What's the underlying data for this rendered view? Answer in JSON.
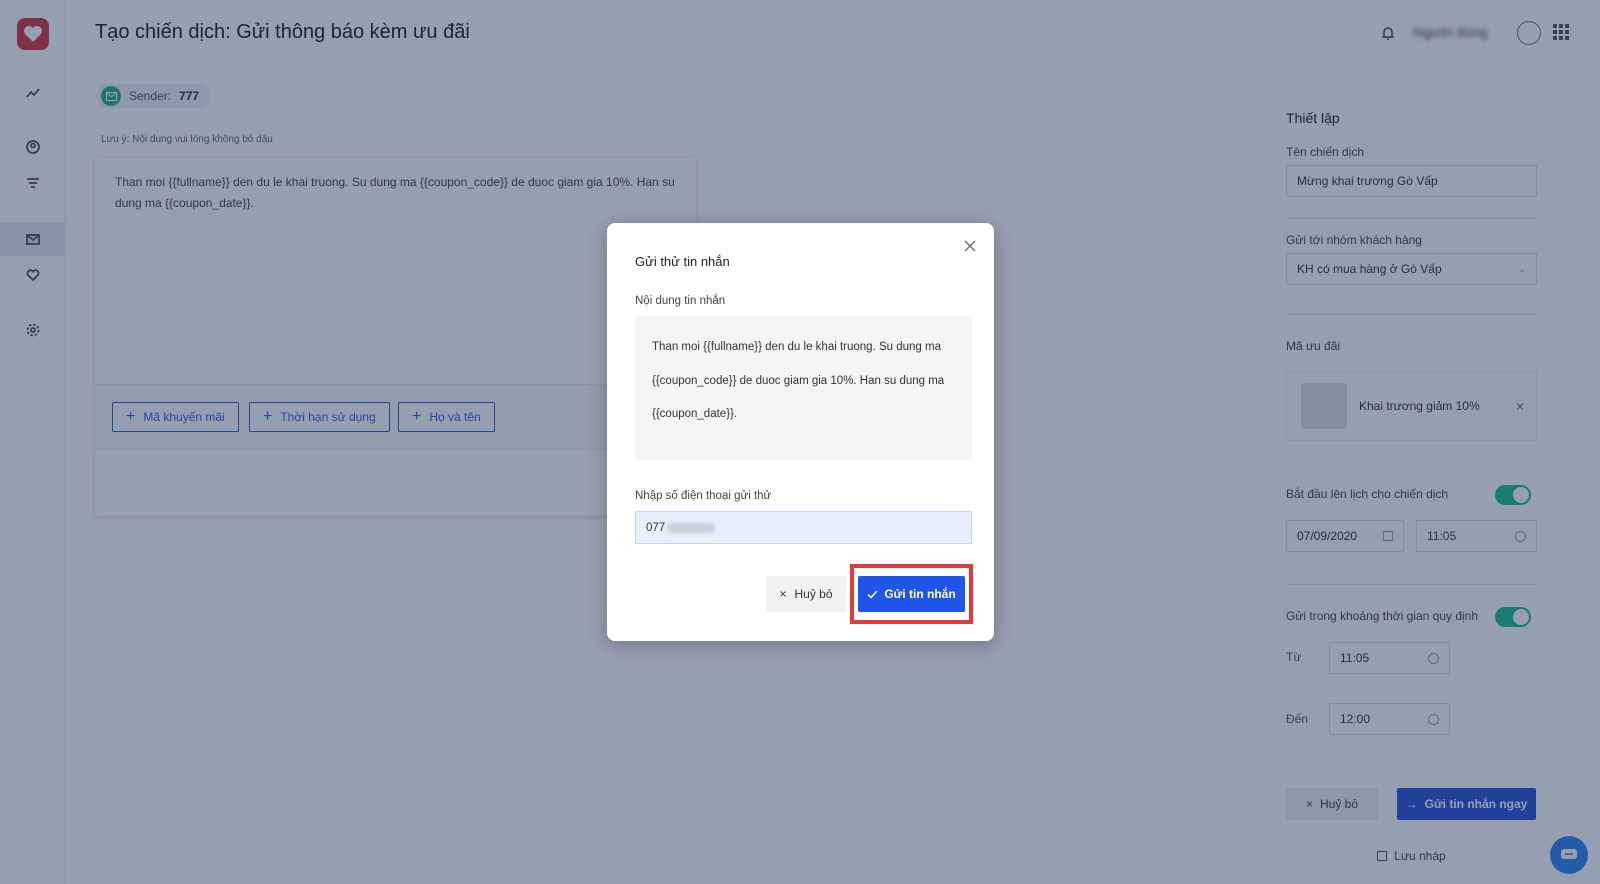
{
  "header": {
    "title": "Tạo chiến dịch: Gửi thông báo kèm ưu đãi",
    "user_name": "Người dùng"
  },
  "sender": {
    "label": "Sender:",
    "value": "777"
  },
  "note": "Lưu ý: Nội dung vui lòng không bỏ dấu",
  "editor": {
    "content": "Than moi {{fullname}} den du le khai truong. Su dung ma {{coupon_code}} de duoc giam gia 10%. Han su dung ma {{coupon_date}}.",
    "tags": [
      "Mã khuyến mãi",
      "Thời hạn sử dụng",
      "Họ và tên"
    ]
  },
  "settings": {
    "title": "Thiết lập",
    "campaign_name_label": "Tên chiến dịch",
    "campaign_name_value": "Mừng khai trương Gò  Vấp",
    "group_label": "Gửi tới nhóm khách hàng",
    "group_value": "KH có mua hàng ở Gò Vấp",
    "coupon_label": "Mã ưu đãi",
    "coupon_name": "Khai trương giảm 10%",
    "schedule_label": "Bắt đầu lên lịch cho chiến dịch",
    "schedule_date": "07/09/2020",
    "schedule_time": "11:05",
    "window_label": "Gửi trong khoảng thời gian quy định",
    "from_label": "Từ",
    "from_value": "11:05",
    "to_label": "Đến",
    "to_value": "12:00",
    "cancel_label": "Huỷ bỏ",
    "send_now_label": "Gửi tin nhắn ngay",
    "draft_label": "Lưu nháp"
  },
  "modal": {
    "title": "Gửi thử tin nhắn",
    "content_label": "Nội dung tin nhắn",
    "content_lines": [
      "Than moi {{fullname}} den du le khai truong. Su dung ma",
      "{{coupon_code}} de duoc giam gia 10%. Han su dung ma",
      "{{coupon_date}}."
    ],
    "phone_label": "Nhập số điện thoại gửi thử",
    "phone_value": "077",
    "cancel_label": "Huỷ bỏ",
    "send_label": "Gửi tin nhắn"
  },
  "colors": {
    "accent": "#1f55e8",
    "highlight": "#e23b3b",
    "toggle_on": "#1fc08c",
    "brand": "#d9373f"
  }
}
